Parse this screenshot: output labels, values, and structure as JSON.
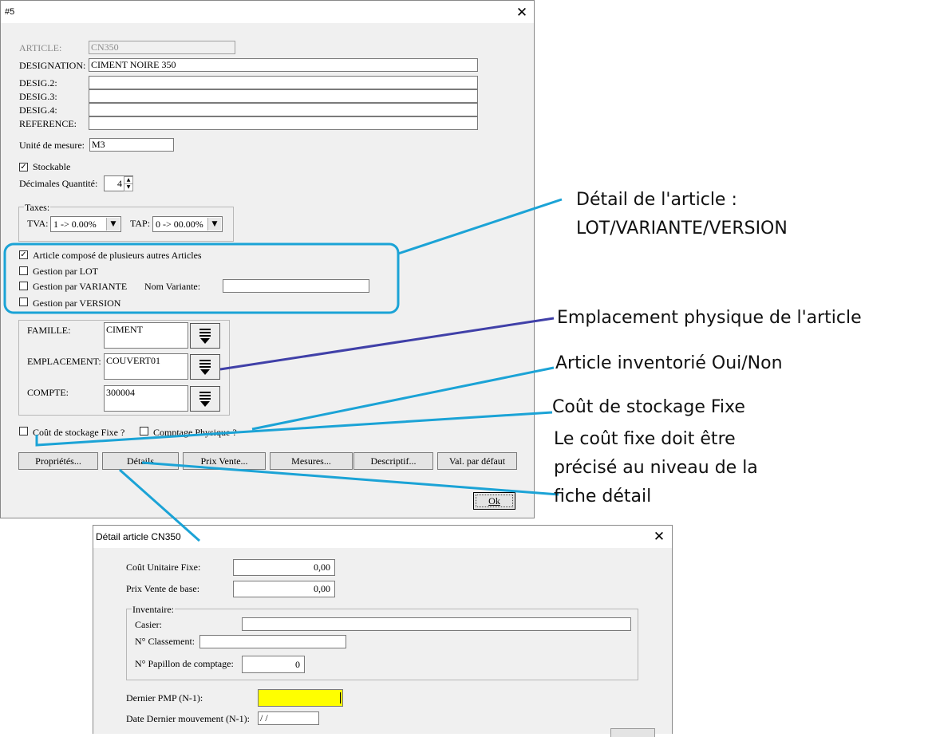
{
  "window": {
    "title": "#5",
    "article_label": "ARTICLE:",
    "article_value": "CN350",
    "designation_label": "DESIGNATION:",
    "designation_value": "CIMENT NOIRE 350",
    "desig2_label": "DESIG.2:",
    "desig3_label": "DESIG.3:",
    "desig4_label": "DESIG.4:",
    "reference_label": "REFERENCE:",
    "unite_label": "Unité de mesure:",
    "unite_value": "M3",
    "stockable_label": "Stockable",
    "decimales_label": "Décimales Quantité:",
    "decimales_value": "4",
    "taxes_title": "Taxes:",
    "tva_label": "TVA:",
    "tva_value": "1 ->  0.00%",
    "tap_label": "TAP:",
    "tap_value": "0 -> 00.00%",
    "options": {
      "compose_label": "Article composé de plusieurs autres Articles",
      "lot_label": "Gestion par LOT",
      "variante_label": "Gestion par VARIANTE",
      "nom_variante_label": "Nom Variante:",
      "version_label": "Gestion par VERSION"
    },
    "famille_label": "FAMILLE:",
    "famille_value": "CIMENT",
    "emplacement_label": "EMPLACEMENT:",
    "emplacement_value": "COUVERT01",
    "compte_label": "COMPTE:",
    "compte_value": "300004",
    "cout_stockage_label": "Coût de stockage Fixe ?",
    "comptage_label": "Comptage Physique ?",
    "buttons": {
      "proprietes": "Propriétés...",
      "details": "Détails",
      "prix_vente": "Prix Vente...",
      "mesures": "Mesures...",
      "descriptif": "Descriptif...",
      "val_defaut": "Val. par défaut",
      "ok": "Ok"
    }
  },
  "detail_window": {
    "title": "Détail article CN350",
    "cout_unitaire_label": "Coût Unitaire Fixe:",
    "cout_unitaire_value": "0,00",
    "prix_vente_label": "Prix Vente de base:",
    "prix_vente_value": "0,00",
    "inventaire_title": "Inventaire:",
    "casier_label": "Casier:",
    "classement_label": "N° Classement:",
    "papillon_label": "N° Papillon de comptage:",
    "papillon_value": "0",
    "pmp_label": "Dernier PMP (N-1):",
    "date_label": "Date Dernier mouvement (N-1):",
    "date_value": " /  /"
  },
  "annotations": {
    "detail_line1": "Détail de l'article :",
    "detail_line2": "LOT/VARIANTE/VERSION",
    "emplacement": "Emplacement physique de l'article",
    "inventorie": "Article inventorié Oui/Non",
    "cout_line1": "Coût de stockage Fixe",
    "cout_line2": "Le coût fixe doit être",
    "cout_line3": "précisé au niveau de la",
    "cout_line4": "fiche détail"
  },
  "colors": {
    "window_bg": "#f0f0f0",
    "callout_blue": "#1ba3d6",
    "callout_purple": "#4040a8",
    "highlight_yellow": "#ffff00"
  }
}
